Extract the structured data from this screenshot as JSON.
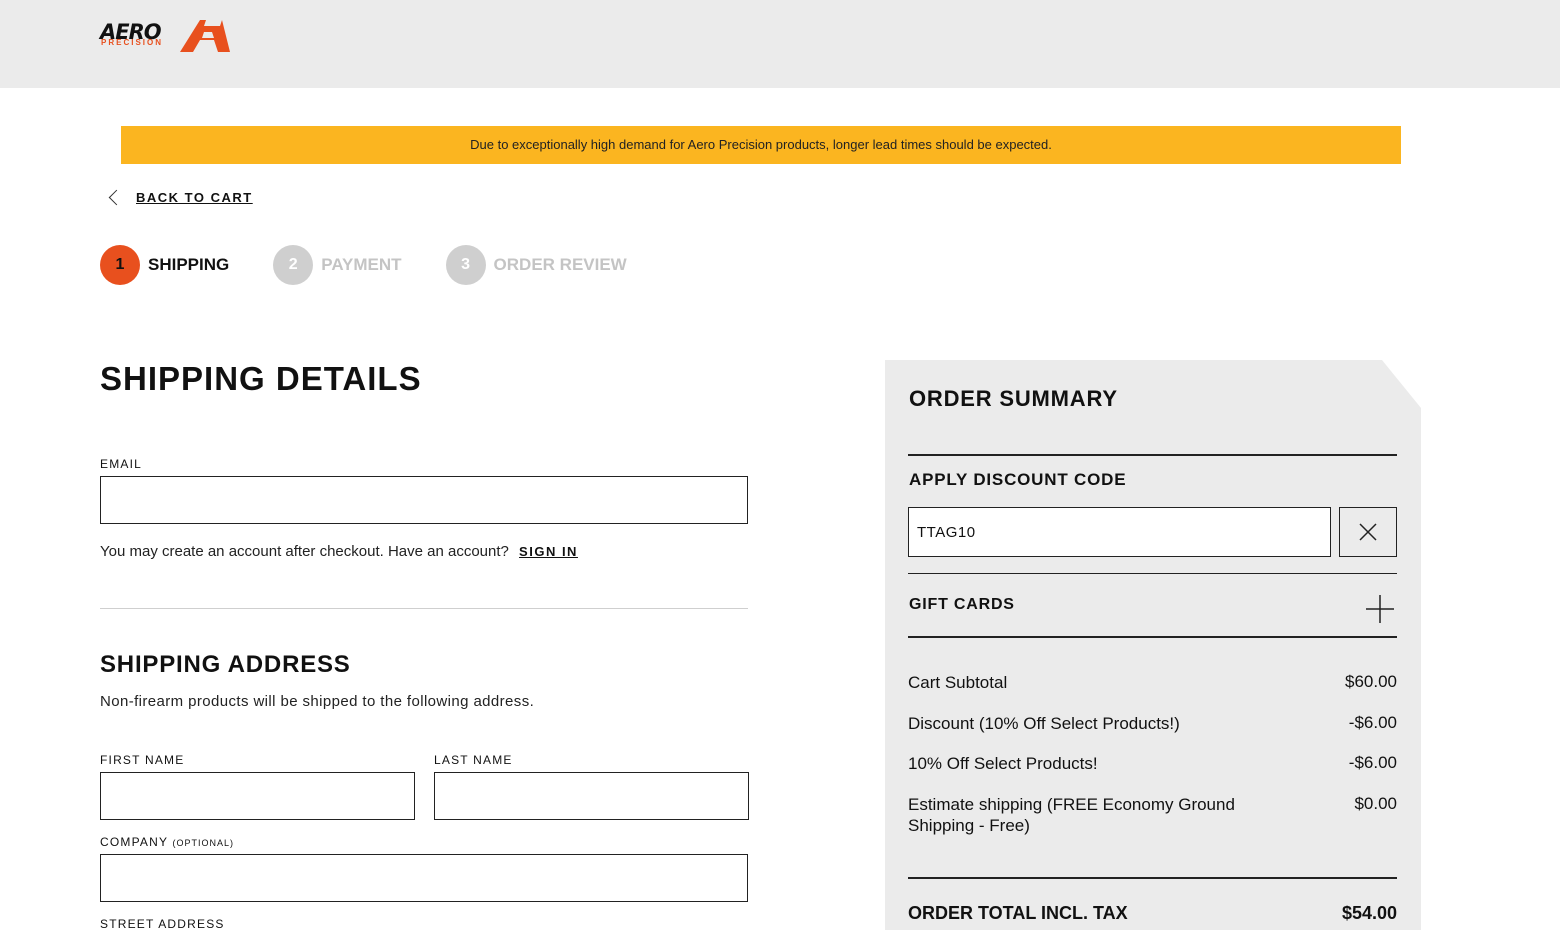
{
  "brand": {
    "name": "AERO",
    "tagline": "PRECISION",
    "accent_color": "#e8501e",
    "banner_color": "#fbb520"
  },
  "banner": {
    "text": "Due to exceptionally high demand for Aero Precision products, longer lead times should be expected."
  },
  "nav": {
    "back_label": "BACK TO CART"
  },
  "steps": [
    {
      "number": "1",
      "label": "SHIPPING",
      "state": "active"
    },
    {
      "number": "2",
      "label": "PAYMENT",
      "state": "inactive"
    },
    {
      "number": "3",
      "label": "ORDER REVIEW",
      "state": "inactive"
    }
  ],
  "shipping_details": {
    "title": "SHIPPING DETAILS",
    "email_label": "EMAIL",
    "email_value": "",
    "account_note": "You may create an account after checkout. Have an account?",
    "sign_in_label": "SIGN IN"
  },
  "shipping_address": {
    "title": "SHIPPING ADDRESS",
    "note": "Non-firearm products will be shipped to the following address.",
    "first_name_label": "FIRST NAME",
    "first_name_value": "",
    "last_name_label": "LAST NAME",
    "last_name_value": "",
    "company_label": "COMPANY",
    "company_optional": "(OPTIONAL)",
    "company_value": "",
    "street_label": "STREET ADDRESS"
  },
  "order_summary": {
    "title": "ORDER SUMMARY",
    "discount_title": "APPLY DISCOUNT CODE",
    "discount_code": "TTAG10",
    "gift_cards_title": "GIFT CARDS",
    "lines": [
      {
        "label": "Cart Subtotal",
        "value": "$60.00"
      },
      {
        "label": "Discount (10% Off Select Products!)",
        "value": "-$6.00"
      },
      {
        "label": "10% Off Select Products!",
        "value": "-$6.00"
      },
      {
        "label": "Estimate shipping (FREE Economy Ground Shipping - Free)",
        "value": "$0.00"
      }
    ],
    "total_label": "ORDER TOTAL INCL. TAX",
    "total_value": "$54.00"
  },
  "icons": {
    "back": "chevron-left-icon",
    "remove_code": "close-icon",
    "expand_gift_cards": "plus-icon"
  }
}
